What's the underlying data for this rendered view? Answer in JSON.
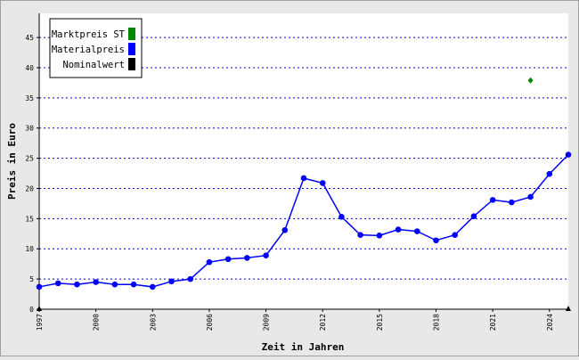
{
  "chart_data": {
    "type": "line",
    "xlabel": "Zeit in Jahren",
    "ylabel": "Preis in Euro",
    "xlim": [
      1997,
      2025
    ],
    "ylim": [
      0,
      49
    ],
    "grid": true,
    "legend_position": "top-left",
    "x_ticks": [
      "1997",
      "2000",
      "2003",
      "2006",
      "2009",
      "2012",
      "2015",
      "2018",
      "2021",
      "2024"
    ],
    "y_ticks": [
      "0",
      "5",
      "10",
      "15",
      "20",
      "25",
      "30",
      "35",
      "40",
      "45"
    ],
    "series": [
      {
        "name": "Marktpreis ST",
        "color": "#008800",
        "marker": "diamond",
        "line": false,
        "points": [
          [
            2023,
            37.9
          ]
        ]
      },
      {
        "name": "Materialpreis",
        "color": "#0000ff",
        "marker": "circle",
        "line": true,
        "points": [
          [
            1997,
            3.7
          ],
          [
            1998,
            4.3
          ],
          [
            1999,
            4.1
          ],
          [
            2000,
            4.5
          ],
          [
            2001,
            4.1
          ],
          [
            2002,
            4.1
          ],
          [
            2003,
            3.7
          ],
          [
            2004,
            4.6
          ],
          [
            2005,
            5.0
          ],
          [
            2006,
            7.8
          ],
          [
            2007,
            8.3
          ],
          [
            2008,
            8.5
          ],
          [
            2009,
            8.9
          ],
          [
            2010,
            13.1
          ],
          [
            2011,
            21.7
          ],
          [
            2012,
            20.9
          ],
          [
            2013,
            15.3
          ],
          [
            2014,
            12.3
          ],
          [
            2015,
            12.2
          ],
          [
            2016,
            13.2
          ],
          [
            2017,
            12.9
          ],
          [
            2018,
            11.4
          ],
          [
            2019,
            12.3
          ],
          [
            2020,
            15.4
          ],
          [
            2021,
            18.1
          ],
          [
            2022,
            17.7
          ],
          [
            2023,
            18.6
          ],
          [
            2024,
            22.4
          ],
          [
            2025,
            25.6
          ]
        ]
      },
      {
        "name": "Nominalwert",
        "color": "#000000",
        "marker": "none",
        "line": false,
        "points": []
      }
    ]
  }
}
